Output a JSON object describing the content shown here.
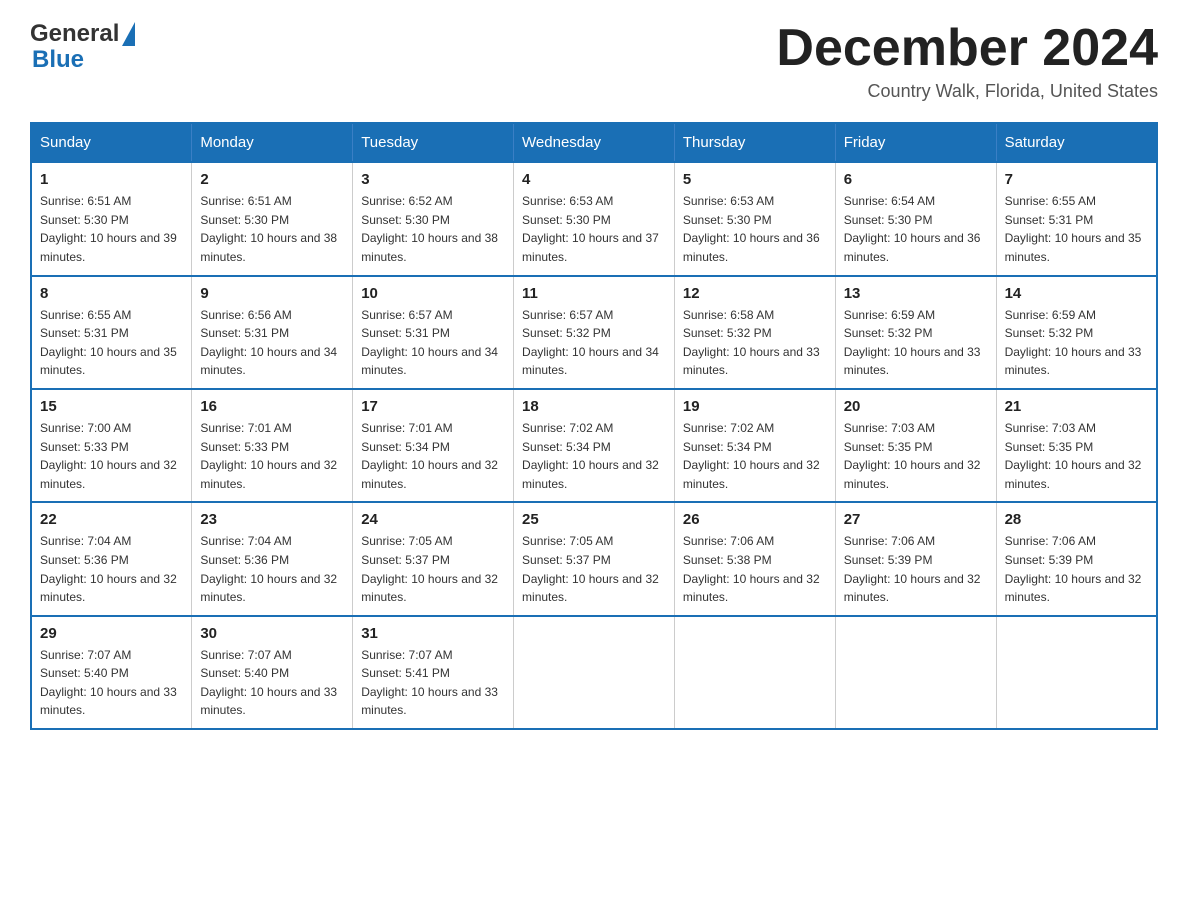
{
  "header": {
    "logo": {
      "general": "General",
      "triangle": "▶",
      "blue": "Blue"
    },
    "title": "December 2024",
    "location": "Country Walk, Florida, United States"
  },
  "calendar": {
    "days_of_week": [
      "Sunday",
      "Monday",
      "Tuesday",
      "Wednesday",
      "Thursday",
      "Friday",
      "Saturday"
    ],
    "weeks": [
      [
        {
          "day": "1",
          "sunrise": "Sunrise: 6:51 AM",
          "sunset": "Sunset: 5:30 PM",
          "daylight": "Daylight: 10 hours and 39 minutes."
        },
        {
          "day": "2",
          "sunrise": "Sunrise: 6:51 AM",
          "sunset": "Sunset: 5:30 PM",
          "daylight": "Daylight: 10 hours and 38 minutes."
        },
        {
          "day": "3",
          "sunrise": "Sunrise: 6:52 AM",
          "sunset": "Sunset: 5:30 PM",
          "daylight": "Daylight: 10 hours and 38 minutes."
        },
        {
          "day": "4",
          "sunrise": "Sunrise: 6:53 AM",
          "sunset": "Sunset: 5:30 PM",
          "daylight": "Daylight: 10 hours and 37 minutes."
        },
        {
          "day": "5",
          "sunrise": "Sunrise: 6:53 AM",
          "sunset": "Sunset: 5:30 PM",
          "daylight": "Daylight: 10 hours and 36 minutes."
        },
        {
          "day": "6",
          "sunrise": "Sunrise: 6:54 AM",
          "sunset": "Sunset: 5:30 PM",
          "daylight": "Daylight: 10 hours and 36 minutes."
        },
        {
          "day": "7",
          "sunrise": "Sunrise: 6:55 AM",
          "sunset": "Sunset: 5:31 PM",
          "daylight": "Daylight: 10 hours and 35 minutes."
        }
      ],
      [
        {
          "day": "8",
          "sunrise": "Sunrise: 6:55 AM",
          "sunset": "Sunset: 5:31 PM",
          "daylight": "Daylight: 10 hours and 35 minutes."
        },
        {
          "day": "9",
          "sunrise": "Sunrise: 6:56 AM",
          "sunset": "Sunset: 5:31 PM",
          "daylight": "Daylight: 10 hours and 34 minutes."
        },
        {
          "day": "10",
          "sunrise": "Sunrise: 6:57 AM",
          "sunset": "Sunset: 5:31 PM",
          "daylight": "Daylight: 10 hours and 34 minutes."
        },
        {
          "day": "11",
          "sunrise": "Sunrise: 6:57 AM",
          "sunset": "Sunset: 5:32 PM",
          "daylight": "Daylight: 10 hours and 34 minutes."
        },
        {
          "day": "12",
          "sunrise": "Sunrise: 6:58 AM",
          "sunset": "Sunset: 5:32 PM",
          "daylight": "Daylight: 10 hours and 33 minutes."
        },
        {
          "day": "13",
          "sunrise": "Sunrise: 6:59 AM",
          "sunset": "Sunset: 5:32 PM",
          "daylight": "Daylight: 10 hours and 33 minutes."
        },
        {
          "day": "14",
          "sunrise": "Sunrise: 6:59 AM",
          "sunset": "Sunset: 5:32 PM",
          "daylight": "Daylight: 10 hours and 33 minutes."
        }
      ],
      [
        {
          "day": "15",
          "sunrise": "Sunrise: 7:00 AM",
          "sunset": "Sunset: 5:33 PM",
          "daylight": "Daylight: 10 hours and 32 minutes."
        },
        {
          "day": "16",
          "sunrise": "Sunrise: 7:01 AM",
          "sunset": "Sunset: 5:33 PM",
          "daylight": "Daylight: 10 hours and 32 minutes."
        },
        {
          "day": "17",
          "sunrise": "Sunrise: 7:01 AM",
          "sunset": "Sunset: 5:34 PM",
          "daylight": "Daylight: 10 hours and 32 minutes."
        },
        {
          "day": "18",
          "sunrise": "Sunrise: 7:02 AM",
          "sunset": "Sunset: 5:34 PM",
          "daylight": "Daylight: 10 hours and 32 minutes."
        },
        {
          "day": "19",
          "sunrise": "Sunrise: 7:02 AM",
          "sunset": "Sunset: 5:34 PM",
          "daylight": "Daylight: 10 hours and 32 minutes."
        },
        {
          "day": "20",
          "sunrise": "Sunrise: 7:03 AM",
          "sunset": "Sunset: 5:35 PM",
          "daylight": "Daylight: 10 hours and 32 minutes."
        },
        {
          "day": "21",
          "sunrise": "Sunrise: 7:03 AM",
          "sunset": "Sunset: 5:35 PM",
          "daylight": "Daylight: 10 hours and 32 minutes."
        }
      ],
      [
        {
          "day": "22",
          "sunrise": "Sunrise: 7:04 AM",
          "sunset": "Sunset: 5:36 PM",
          "daylight": "Daylight: 10 hours and 32 minutes."
        },
        {
          "day": "23",
          "sunrise": "Sunrise: 7:04 AM",
          "sunset": "Sunset: 5:36 PM",
          "daylight": "Daylight: 10 hours and 32 minutes."
        },
        {
          "day": "24",
          "sunrise": "Sunrise: 7:05 AM",
          "sunset": "Sunset: 5:37 PM",
          "daylight": "Daylight: 10 hours and 32 minutes."
        },
        {
          "day": "25",
          "sunrise": "Sunrise: 7:05 AM",
          "sunset": "Sunset: 5:37 PM",
          "daylight": "Daylight: 10 hours and 32 minutes."
        },
        {
          "day": "26",
          "sunrise": "Sunrise: 7:06 AM",
          "sunset": "Sunset: 5:38 PM",
          "daylight": "Daylight: 10 hours and 32 minutes."
        },
        {
          "day": "27",
          "sunrise": "Sunrise: 7:06 AM",
          "sunset": "Sunset: 5:39 PM",
          "daylight": "Daylight: 10 hours and 32 minutes."
        },
        {
          "day": "28",
          "sunrise": "Sunrise: 7:06 AM",
          "sunset": "Sunset: 5:39 PM",
          "daylight": "Daylight: 10 hours and 32 minutes."
        }
      ],
      [
        {
          "day": "29",
          "sunrise": "Sunrise: 7:07 AM",
          "sunset": "Sunset: 5:40 PM",
          "daylight": "Daylight: 10 hours and 33 minutes."
        },
        {
          "day": "30",
          "sunrise": "Sunrise: 7:07 AM",
          "sunset": "Sunset: 5:40 PM",
          "daylight": "Daylight: 10 hours and 33 minutes."
        },
        {
          "day": "31",
          "sunrise": "Sunrise: 7:07 AM",
          "sunset": "Sunset: 5:41 PM",
          "daylight": "Daylight: 10 hours and 33 minutes."
        },
        {
          "day": "",
          "sunrise": "",
          "sunset": "",
          "daylight": ""
        },
        {
          "day": "",
          "sunrise": "",
          "sunset": "",
          "daylight": ""
        },
        {
          "day": "",
          "sunrise": "",
          "sunset": "",
          "daylight": ""
        },
        {
          "day": "",
          "sunrise": "",
          "sunset": "",
          "daylight": ""
        }
      ]
    ]
  }
}
